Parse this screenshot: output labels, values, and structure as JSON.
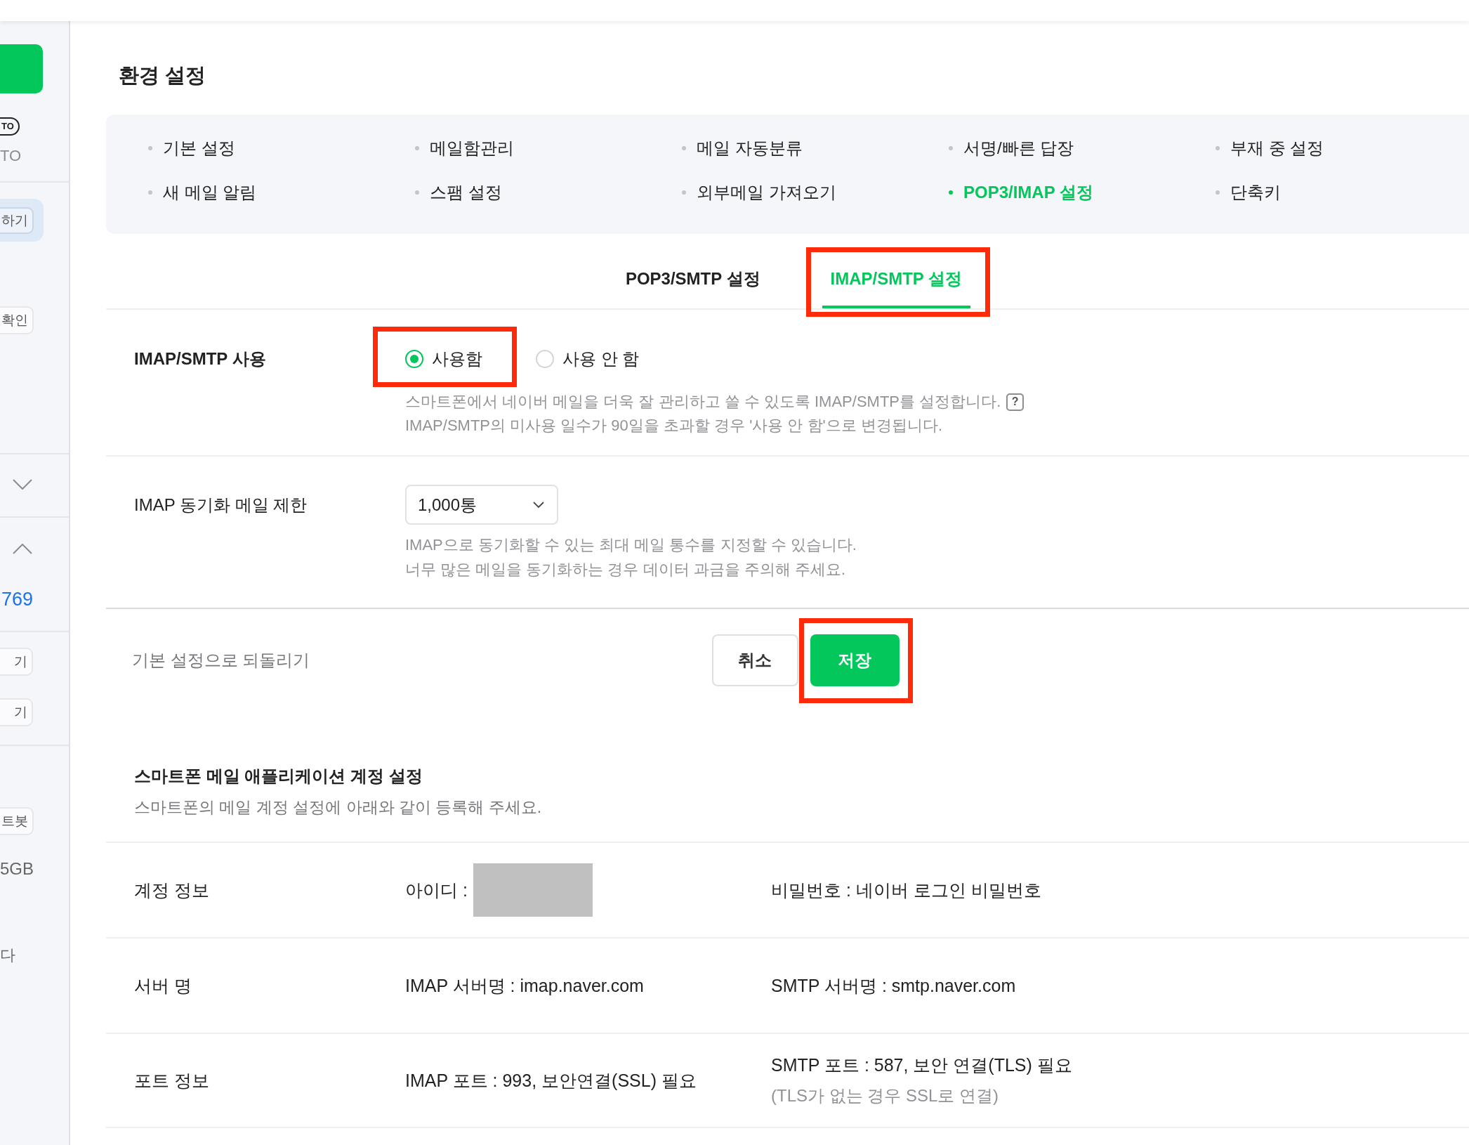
{
  "sidebar": {
    "badge": "TO",
    "badge_caption": "TO",
    "highlight_button": "하기",
    "check_button": "확인",
    "toggles": [
      {
        "expanded": false
      },
      {
        "expanded": true
      }
    ],
    "count": "769",
    "buttons": [
      "기",
      "기"
    ],
    "bot_button": "트봇",
    "storage": "5GB",
    "note": "다"
  },
  "page_title": "환경 설정",
  "settings_menu": [
    {
      "label": "기본 설정",
      "selected": false
    },
    {
      "label": "메일함관리",
      "selected": false
    },
    {
      "label": "메일 자동분류",
      "selected": false
    },
    {
      "label": "서명/빠른 답장",
      "selected": false
    },
    {
      "label": "부재 중 설정",
      "selected": false
    },
    {
      "label": "새 메일 알림",
      "selected": false
    },
    {
      "label": "스팸 설정",
      "selected": false
    },
    {
      "label": "외부메일 가져오기",
      "selected": false
    },
    {
      "label": "POP3/IMAP 설정",
      "selected": true
    },
    {
      "label": "단축키",
      "selected": false
    }
  ],
  "tabs": [
    {
      "label": "POP3/SMTP 설정",
      "selected": false,
      "annotated": false
    },
    {
      "label": "IMAP/SMTP 설정",
      "selected": true,
      "annotated": true
    }
  ],
  "imap_use": {
    "label": "IMAP/SMTP 사용",
    "options": [
      {
        "label": "사용함",
        "selected": true,
        "annotated": true
      },
      {
        "label": "사용 안 함",
        "selected": false,
        "annotated": false
      }
    ],
    "description": [
      "스마트폰에서 네이버 메일을 더욱 잘 관리하고 쓸 수 있도록 IMAP/SMTP를 설정합니다.",
      "IMAP/SMTP의 미사용 일수가 90일을 초과할 경우 '사용 안 함'으로 변경됩니다."
    ],
    "help": "?"
  },
  "sync_limit": {
    "label": "IMAP 동기화 메일 제한",
    "value": "1,000통",
    "description": [
      "IMAP으로 동기화할 수 있는 최대 메일 통수를 지정할 수 있습니다.",
      "너무 많은 메일을 동기화하는 경우 데이터 과금을 주의해 주세요."
    ]
  },
  "actions": {
    "reset": "기본 설정으로 되돌리기",
    "buttons": [
      {
        "label": "취소",
        "kind": "cancel",
        "annotated": false
      },
      {
        "label": "저장",
        "kind": "save",
        "annotated": true
      }
    ]
  },
  "account_setup": {
    "title": "스마트폰 메일 애플리케이션 계정 설정",
    "subtitle": "스마트폰의 메일 계정 설정에 아래와 같이 등록해 주세요.",
    "rows": [
      {
        "label": "계정 정보",
        "cells": [
          {
            "kind": "redacted",
            "text": "아이디 :"
          },
          {
            "kind": "plain",
            "text": "비밀번호 : 네이버 로그인 비밀번호"
          }
        ]
      },
      {
        "label": "서버 명",
        "cells": [
          {
            "kind": "plain",
            "text": "IMAP 서버명 : imap.naver.com"
          },
          {
            "kind": "plain",
            "text": "SMTP 서버명 : smtp.naver.com"
          }
        ]
      },
      {
        "label": "포트 정보",
        "cells": [
          {
            "kind": "plain",
            "text": "IMAP 포트 : 993, 보안연결(SSL) 필요"
          },
          {
            "kind": "plain",
            "text": "SMTP 포트 : 587, 보안 연결(TLS) 필요",
            "note": "(TLS가 없는 경우 SSL로 연결)"
          }
        ]
      }
    ]
  }
}
